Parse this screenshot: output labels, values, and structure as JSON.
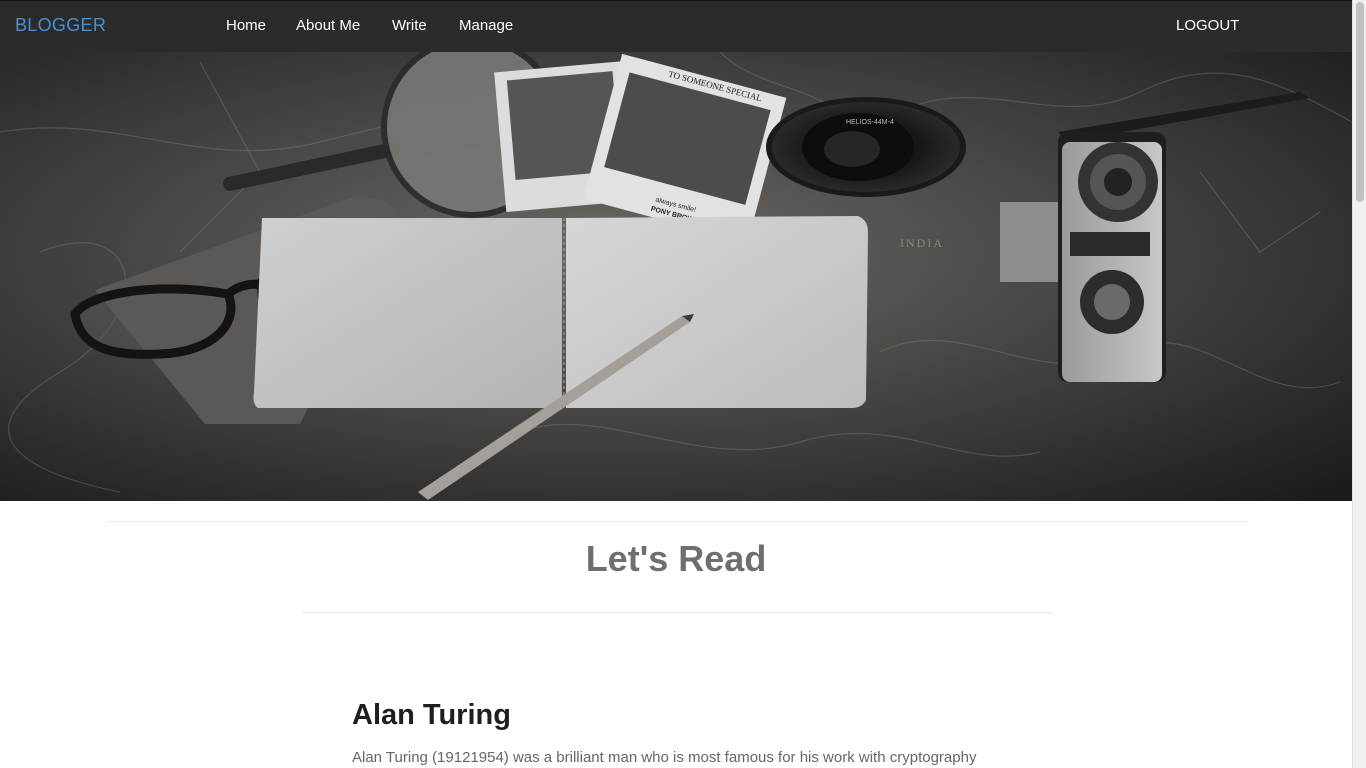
{
  "navbar": {
    "brand": "BLOGGER",
    "links": [
      "Home",
      "About Me",
      "Write",
      "Manage"
    ],
    "logout": "LOGOUT",
    "brand_color": "#4a8fd1",
    "background": "#2b2b2b"
  },
  "hero": {
    "polaroid_title": "TO SOMEONE SPECIAL",
    "polaroid_caption_1": "always smile!",
    "polaroid_caption_2": "PONY BROWN",
    "lens_text": "HELIOS-44M-4",
    "map_label": "INDIA"
  },
  "main": {
    "section_title": "Let's Read",
    "posts": [
      {
        "title": "Alan Turing",
        "excerpt": "Alan Turing (19121954) was a brilliant man who is most famous for his work with cryptography"
      }
    ]
  }
}
